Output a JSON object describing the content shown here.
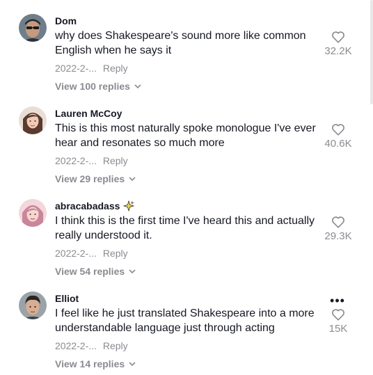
{
  "comments": [
    {
      "username": "Dom",
      "text": "why does Shakespeare's sound more like common English when he says it",
      "date": "2022-2-...",
      "reply_label": "Reply",
      "view_replies": "View 100 replies",
      "likes": "32.2K"
    },
    {
      "username": "Lauren McCoy",
      "text": "This is this most naturally spoke monologue I've ever hear and resonates so much more",
      "date": "2022-2-...",
      "reply_label": "Reply",
      "view_replies": "View 29 replies",
      "likes": "40.6K"
    },
    {
      "username": "abracabadass",
      "text": "I think this is the first time I've heard this and actually really understood it.",
      "date": "2022-2-...",
      "reply_label": "Reply",
      "view_replies": "View 54 replies",
      "likes": "29.3K"
    },
    {
      "username": "Elliot",
      "text": "I feel like he just translated Shakespeare into a more understandable language just through acting",
      "date": "2022-2-...",
      "reply_label": "Reply",
      "view_replies": "View 14 replies",
      "likes": "15K",
      "more_label": "•••"
    }
  ],
  "icons": {
    "like": "heart-outline-icon",
    "expand": "chevron-down-icon",
    "badge": "sparkle-icon",
    "more": "more-options-icon"
  },
  "colors": {
    "text_primary": "#161823",
    "text_secondary": "#8a8b91",
    "background": "#ffffff"
  }
}
